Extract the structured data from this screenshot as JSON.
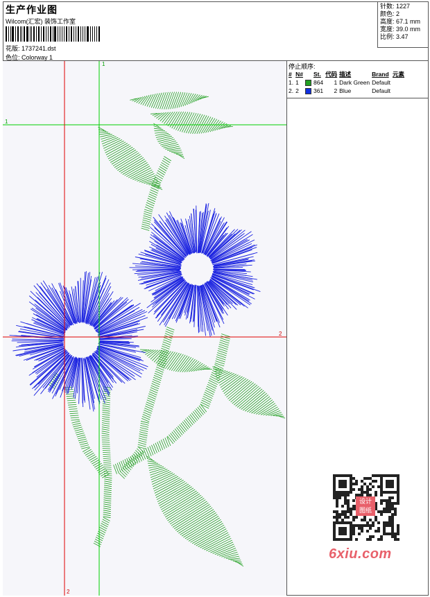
{
  "header": {
    "title": "生产作业图",
    "studio": "Wilcom(汇宏) 装饰工作室",
    "design_label": "花版: 1737241.dst",
    "colorway_label": "色位: Colorway 1"
  },
  "stats": {
    "stitches": "针数: 1227",
    "colors": "颜色: 2",
    "height": "高度: 67.1 mm",
    "width": "宽度: 39.0 mm",
    "scale": "比例: 3.47"
  },
  "stop_sequence": {
    "title": "停止顺序:",
    "headers": [
      "#",
      "N#",
      "St.",
      "代码",
      "描述",
      "Brand",
      "元素"
    ],
    "rows": [
      {
        "idx": "1.",
        "n": "1",
        "swatch": "#22a022",
        "code": "864",
        "st": "1",
        "desc": "Dark Green",
        "brand": "Default"
      },
      {
        "idx": "2.",
        "n": "2",
        "swatch": "#1030e0",
        "code": "361",
        "st": "2",
        "desc": "Blue",
        "brand": "Default"
      }
    ]
  },
  "guides": {
    "label_1": "1",
    "label_2": "2"
  },
  "colors": {
    "green": "#22a022",
    "blue": "#1a22e0",
    "guide_red": "#e00000",
    "guide_green": "#00d000"
  },
  "watermark": {
    "logo_text": "设计 图纸",
    "site": "6xiu.com"
  }
}
